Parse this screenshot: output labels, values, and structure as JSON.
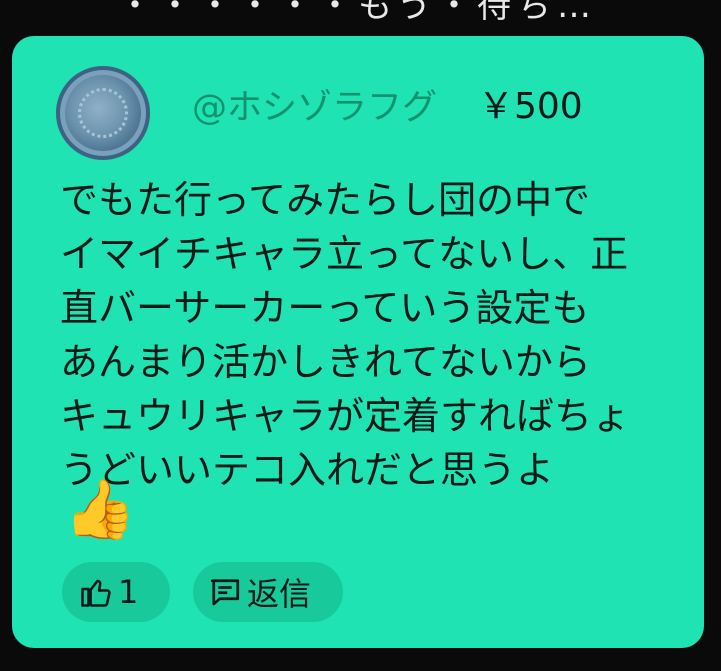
{
  "top_strip": {
    "partial_text": "・・・・・・もう・待ち…"
  },
  "comment_card": {
    "background_color": "#1fe3b3",
    "username": "@ホシゾラフグ",
    "amount": "￥500",
    "body_lines": [
      "でもた行ってみたらし団の中で",
      "イマイチキャラ立ってないし、正",
      "直バーサーカーっていう設定も",
      "あんまり活かしきれてないから",
      "キュウリキャラが定着すればちょ",
      "うどいいテコ入れだと思うよ"
    ],
    "emoji": "👍",
    "actions": {
      "like_icon": "thumbs-up-icon",
      "like_count": "1",
      "reply_icon": "comment-icon",
      "reply_label": "返信"
    }
  }
}
